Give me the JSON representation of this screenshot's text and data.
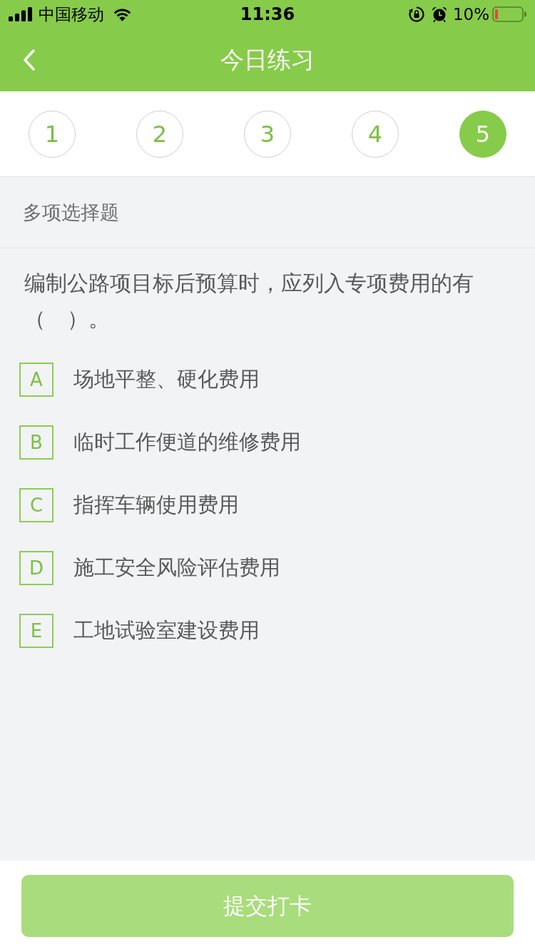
{
  "status_bar": {
    "carrier": "中国移动",
    "time": "11:36",
    "battery": "10%"
  },
  "nav": {
    "title": "今日练习"
  },
  "steps": [
    {
      "label": "1",
      "selected": false
    },
    {
      "label": "2",
      "selected": false
    },
    {
      "label": "3",
      "selected": false
    },
    {
      "label": "4",
      "selected": false
    },
    {
      "label": "5",
      "selected": true
    }
  ],
  "question": {
    "type": "多项选择题",
    "text": "编制公路项目标后预算时，应列入专项费用的有（　）。",
    "options": [
      {
        "letter": "A",
        "text": "场地平整、硬化费用",
        "selected": false
      },
      {
        "letter": "B",
        "text": "临时工作便道的维修费用",
        "selected": false
      },
      {
        "letter": "C",
        "text": "指挥车辆使用费用",
        "selected": false
      },
      {
        "letter": "D",
        "text": "施工安全风险评估费用",
        "selected": false
      },
      {
        "letter": "E",
        "text": "工地试验室建设费用",
        "selected": false
      }
    ]
  },
  "submit": {
    "label": "提交打卡",
    "disabled": true
  }
}
